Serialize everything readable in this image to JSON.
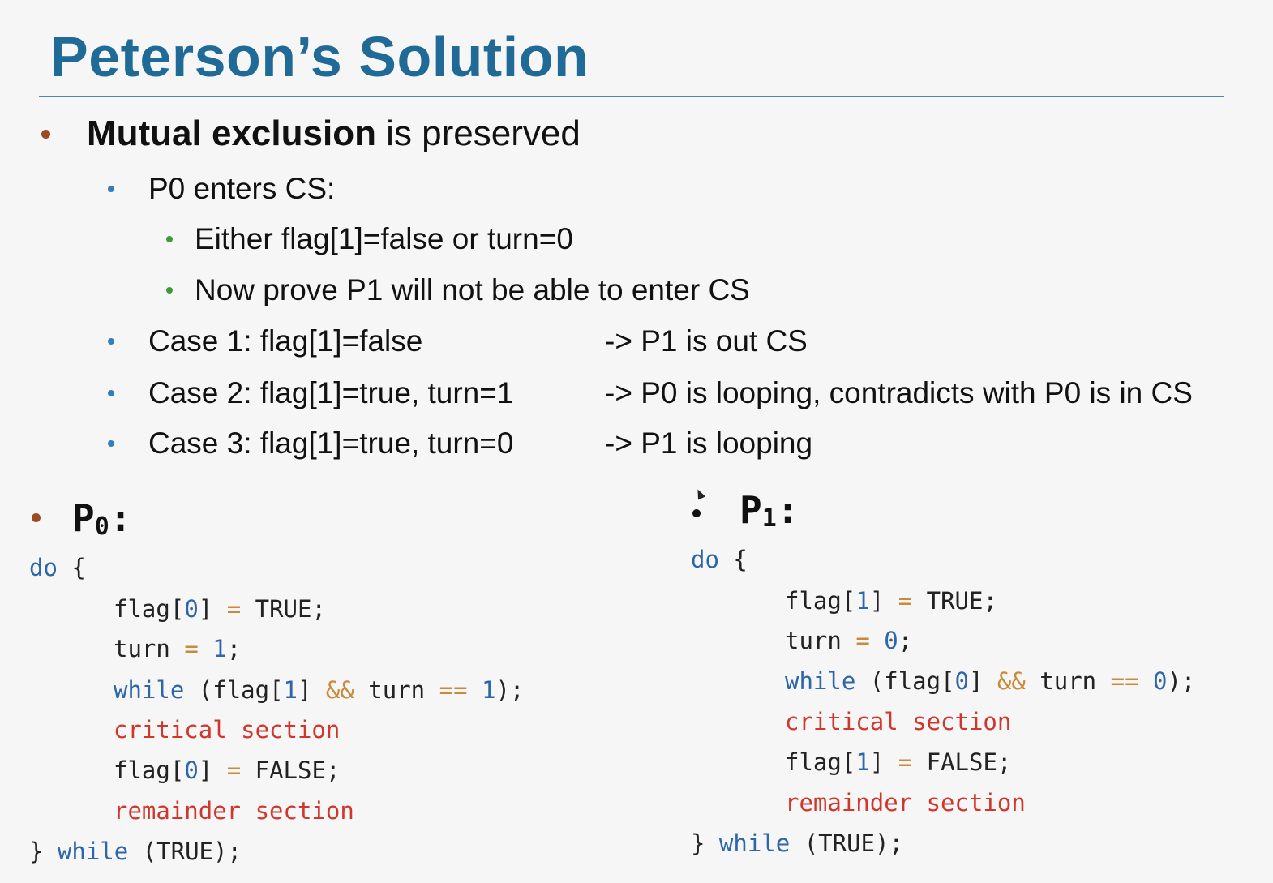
{
  "title": "Peterson’s Solution",
  "bullets": {
    "main_bold": "Mutual exclusion",
    "main_rest": " is preserved",
    "p0_enters": "P0 enters CS:",
    "either": "Either flag[1]=false or turn=0",
    "now_prove": "Now prove P1 will not be able to enter CS",
    "cases": [
      {
        "label": "Case 1: flag[1]=false",
        "result": "-> P1 is out CS"
      },
      {
        "label": "Case 2: flag[1]=true, turn=1",
        "result": "-> P0 is looping, contradicts with P0 is in CS"
      },
      {
        "label": "Case 3: flag[1]=true, turn=0",
        "result": "-> P1 is looping"
      }
    ]
  },
  "p0": {
    "name": "P",
    "sub": "0",
    "colon": ":",
    "lines": {
      "do": "do",
      "brace_open": " {",
      "flag_set": "flag[",
      "idx": "0",
      "true_val": "TRUE;",
      "turn": "turn",
      "turn_val": "1",
      "while_kw": "while",
      "while_cond_a": " (flag[",
      "while_idx": "1",
      "while_cond_b": "] ",
      "and_op": "&&",
      "while_cond_c": " turn ",
      "eq_op": "==",
      "while_val": "1",
      "while_end": ");",
      "critical": "critical section",
      "false_val": "FALSE;",
      "remainder": "remainder section",
      "close": "} ",
      "while_true": " (TRUE);"
    }
  },
  "p1": {
    "name": "P",
    "sub": "1",
    "colon": ":",
    "lines": {
      "do": "do",
      "brace_open": " {",
      "flag_set": "flag[",
      "idx": "1",
      "true_val": "TRUE;",
      "turn": "turn",
      "turn_val": "0",
      "while_kw": "while",
      "while_cond_a": " (flag[",
      "while_idx": "0",
      "while_cond_b": "] ",
      "and_op": "&&",
      "while_cond_c": " turn ",
      "eq_op": "==",
      "while_val": "0",
      "while_end": ");",
      "critical": "critical section",
      "false_val": "FALSE;",
      "remainder": "remainder section",
      "close": "} ",
      "while_true": " (TRUE);"
    }
  },
  "colors": {
    "title": "#1f6a96",
    "keyword": "#2e66a8",
    "operator": "#c98a3a",
    "section": "#d0362c",
    "bullet_l1": "#9a4a24",
    "bullet_l2": "#2f7fc1",
    "bullet_l3": "#3f9a3a"
  }
}
